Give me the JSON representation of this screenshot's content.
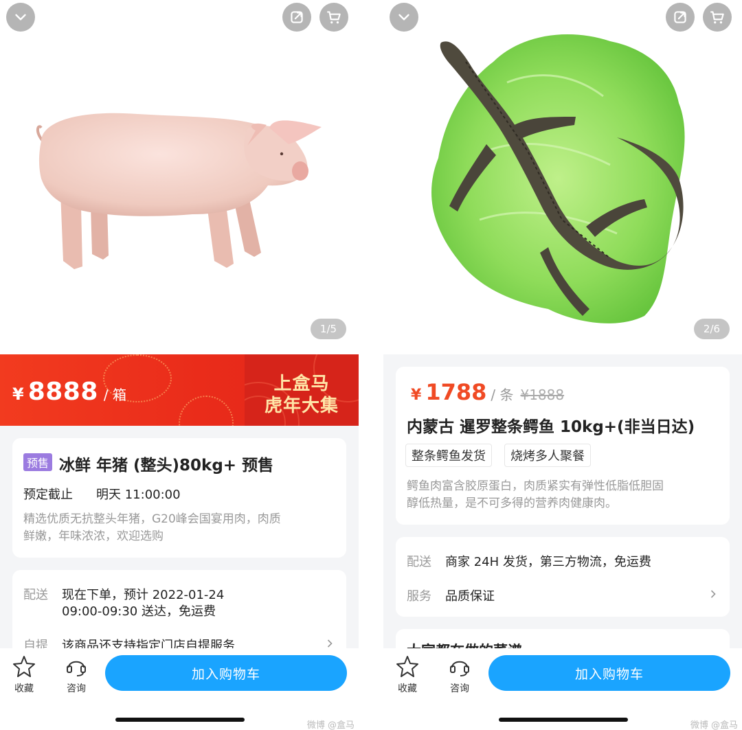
{
  "left": {
    "page_indicator": "1/5",
    "price": {
      "symbol": "¥",
      "amount": "8888",
      "unit": "/ 箱"
    },
    "promo": {
      "line1": "上盒马",
      "line2": "虎年大集"
    },
    "product": {
      "tag": "预售",
      "title": "冰鲜 年猪 (整头)80kg+  预售",
      "deadline_label": "预定截止",
      "deadline_value": "明天 11:00:00",
      "desc_line1": "精选优质无抗整头年猪，G20峰会国宴用肉，肉质",
      "desc_line2": "鲜嫩，年味浓浓，欢迎选购"
    },
    "delivery": {
      "label": "配送",
      "value_line1": "现在下单，预计 2022-01-24",
      "value_line2": "09:00-09:30 送达，免运费",
      "pickup_label": "自提",
      "pickup_value": "该商品还支持指定门店自提服务"
    },
    "bottom": {
      "favorite": "收藏",
      "consult": "咨询",
      "add_to_cart": "加入购物车",
      "watermark": "微博 @盒马"
    }
  },
  "right": {
    "page_indicator": "2/6",
    "price": {
      "symbol": "¥",
      "amount": "1788",
      "unit": "/ 条",
      "original": "¥1888"
    },
    "product": {
      "title": "内蒙古 暹罗整条鳄鱼 10kg+(非当日达)",
      "chips": [
        "整条鳄鱼发货",
        "烧烤多人聚餐"
      ],
      "desc_line1": "鳄鱼肉富含胶原蛋白，肉质紧实有弹性低脂低胆固",
      "desc_line2": "醇低热量，是不可多得的营养肉健康肉。"
    },
    "delivery": {
      "label": "配送",
      "value": "商家 24H 发货，第三方物流，免运费",
      "service_label": "服务",
      "service_value": "品质保证"
    },
    "recipes_heading": "大家都在做的菜谱",
    "bottom": {
      "favorite": "收藏",
      "consult": "咨询",
      "add_to_cart": "加入购物车",
      "watermark": "微博 @盒马"
    }
  },
  "colors": {
    "accent_blue": "#1aa4ff",
    "price_red": "#f04a24",
    "banner_red": "#e92b1a",
    "presale_purple": "#9b7be0"
  }
}
